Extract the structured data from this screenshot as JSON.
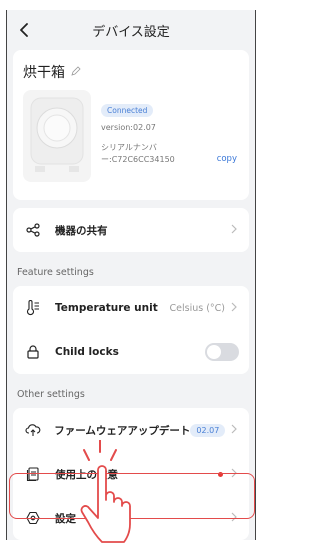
{
  "header": {
    "title": "デバイス設定"
  },
  "device": {
    "name": "烘干箱",
    "status": "Connected",
    "version": "version:02.07",
    "serial_line1": "シリアルナンバ",
    "serial_line2": "ー:C72C6CC34150",
    "copy_label": "copy"
  },
  "share": {
    "label": "機器の共有"
  },
  "feature_settings": {
    "section_label": "Feature settings",
    "temperature_unit": {
      "label": "Temperature unit",
      "value": "Celsius (°C)"
    },
    "child_locks": {
      "label": "Child locks",
      "enabled": false
    }
  },
  "other_settings": {
    "section_label": "Other settings",
    "firmware": {
      "label": "ファームウェアアップデート",
      "badge": "02.07"
    },
    "notes": {
      "label": "使用上の注意"
    },
    "settings": {
      "label": "設定"
    }
  },
  "colors": {
    "accent": "#3b78d8",
    "badge_bg": "#e3ecf9",
    "highlight": "#e34b4b",
    "alert_dot": "#e53935",
    "background": "#f2f3f5"
  }
}
